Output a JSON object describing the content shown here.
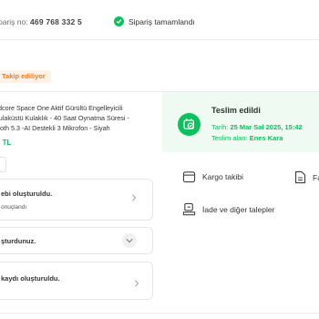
{
  "header": {
    "order_label": "pariş no:",
    "order_number": "469 768 332 5",
    "status": "Sipariş tamamlandı"
  },
  "badge": {
    "label": "Takip ediliyor"
  },
  "product": {
    "name": "ndcore Space One Aktif Gürültü Engelleyicili Kulaküstü Kulaklık - 40 Saat Oynatma Süresi - tooth 5.3 -AI Destekli 3 Mikrofon - Siyah",
    "price": "0 TL"
  },
  "cards": [
    {
      "title": "ebi oluşturuldu.",
      "sub": "onuçlandı"
    },
    {
      "title": "şturdunuz.",
      "sub": ""
    },
    {
      "title": "kaydı oluşturuldu.",
      "sub": ""
    }
  ],
  "delivery": {
    "title": "Teslim edildi",
    "date_label": "Tarih:",
    "date_value": "25 Mar Sal 2025, 15:42",
    "receiver_label": "Teslim alan:",
    "receiver_value": "Enes Kara"
  },
  "actions": {
    "tracking": "Kargo takibi",
    "invoice": "Fa",
    "returns": "İade ve diğer talepler"
  },
  "colors": {
    "success": "#0bc15c",
    "accent": "#f27a1a",
    "delivered_bg": "#eefaf2"
  },
  "icons": [
    "check-circle-icon",
    "package-check-icon",
    "package-icon",
    "invoice-icon",
    "return-box-icon",
    "chevron-right-icon",
    "chevron-down-icon"
  ]
}
